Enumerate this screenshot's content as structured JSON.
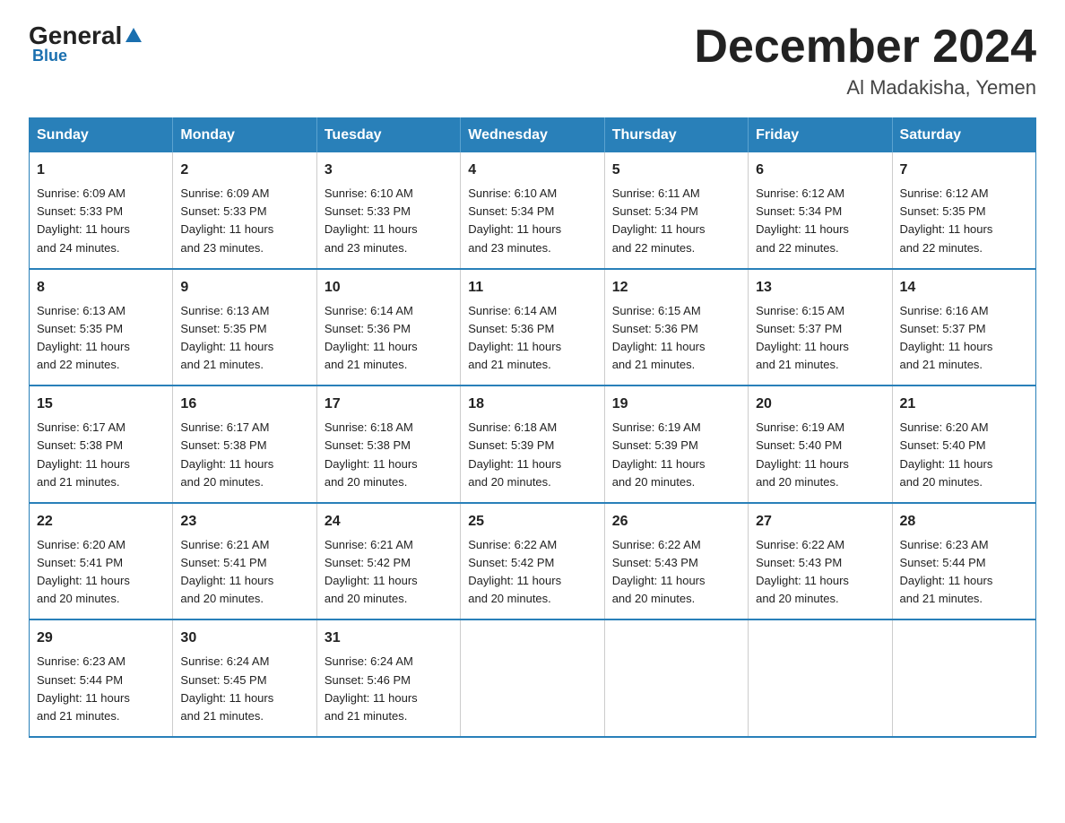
{
  "logo": {
    "general": "General",
    "blue": "Blue"
  },
  "header": {
    "month": "December 2024",
    "location": "Al Madakisha, Yemen"
  },
  "weekdays": [
    "Sunday",
    "Monday",
    "Tuesday",
    "Wednesday",
    "Thursday",
    "Friday",
    "Saturday"
  ],
  "weeks": [
    [
      {
        "day": "1",
        "sunrise": "6:09 AM",
        "sunset": "5:33 PM",
        "daylight": "11 hours and 24 minutes."
      },
      {
        "day": "2",
        "sunrise": "6:09 AM",
        "sunset": "5:33 PM",
        "daylight": "11 hours and 23 minutes."
      },
      {
        "day": "3",
        "sunrise": "6:10 AM",
        "sunset": "5:33 PM",
        "daylight": "11 hours and 23 minutes."
      },
      {
        "day": "4",
        "sunrise": "6:10 AM",
        "sunset": "5:34 PM",
        "daylight": "11 hours and 23 minutes."
      },
      {
        "day": "5",
        "sunrise": "6:11 AM",
        "sunset": "5:34 PM",
        "daylight": "11 hours and 22 minutes."
      },
      {
        "day": "6",
        "sunrise": "6:12 AM",
        "sunset": "5:34 PM",
        "daylight": "11 hours and 22 minutes."
      },
      {
        "day": "7",
        "sunrise": "6:12 AM",
        "sunset": "5:35 PM",
        "daylight": "11 hours and 22 minutes."
      }
    ],
    [
      {
        "day": "8",
        "sunrise": "6:13 AM",
        "sunset": "5:35 PM",
        "daylight": "11 hours and 22 minutes."
      },
      {
        "day": "9",
        "sunrise": "6:13 AM",
        "sunset": "5:35 PM",
        "daylight": "11 hours and 21 minutes."
      },
      {
        "day": "10",
        "sunrise": "6:14 AM",
        "sunset": "5:36 PM",
        "daylight": "11 hours and 21 minutes."
      },
      {
        "day": "11",
        "sunrise": "6:14 AM",
        "sunset": "5:36 PM",
        "daylight": "11 hours and 21 minutes."
      },
      {
        "day": "12",
        "sunrise": "6:15 AM",
        "sunset": "5:36 PM",
        "daylight": "11 hours and 21 minutes."
      },
      {
        "day": "13",
        "sunrise": "6:15 AM",
        "sunset": "5:37 PM",
        "daylight": "11 hours and 21 minutes."
      },
      {
        "day": "14",
        "sunrise": "6:16 AM",
        "sunset": "5:37 PM",
        "daylight": "11 hours and 21 minutes."
      }
    ],
    [
      {
        "day": "15",
        "sunrise": "6:17 AM",
        "sunset": "5:38 PM",
        "daylight": "11 hours and 21 minutes."
      },
      {
        "day": "16",
        "sunrise": "6:17 AM",
        "sunset": "5:38 PM",
        "daylight": "11 hours and 20 minutes."
      },
      {
        "day": "17",
        "sunrise": "6:18 AM",
        "sunset": "5:38 PM",
        "daylight": "11 hours and 20 minutes."
      },
      {
        "day": "18",
        "sunrise": "6:18 AM",
        "sunset": "5:39 PM",
        "daylight": "11 hours and 20 minutes."
      },
      {
        "day": "19",
        "sunrise": "6:19 AM",
        "sunset": "5:39 PM",
        "daylight": "11 hours and 20 minutes."
      },
      {
        "day": "20",
        "sunrise": "6:19 AM",
        "sunset": "5:40 PM",
        "daylight": "11 hours and 20 minutes."
      },
      {
        "day": "21",
        "sunrise": "6:20 AM",
        "sunset": "5:40 PM",
        "daylight": "11 hours and 20 minutes."
      }
    ],
    [
      {
        "day": "22",
        "sunrise": "6:20 AM",
        "sunset": "5:41 PM",
        "daylight": "11 hours and 20 minutes."
      },
      {
        "day": "23",
        "sunrise": "6:21 AM",
        "sunset": "5:41 PM",
        "daylight": "11 hours and 20 minutes."
      },
      {
        "day": "24",
        "sunrise": "6:21 AM",
        "sunset": "5:42 PM",
        "daylight": "11 hours and 20 minutes."
      },
      {
        "day": "25",
        "sunrise": "6:22 AM",
        "sunset": "5:42 PM",
        "daylight": "11 hours and 20 minutes."
      },
      {
        "day": "26",
        "sunrise": "6:22 AM",
        "sunset": "5:43 PM",
        "daylight": "11 hours and 20 minutes."
      },
      {
        "day": "27",
        "sunrise": "6:22 AM",
        "sunset": "5:43 PM",
        "daylight": "11 hours and 20 minutes."
      },
      {
        "day": "28",
        "sunrise": "6:23 AM",
        "sunset": "5:44 PM",
        "daylight": "11 hours and 21 minutes."
      }
    ],
    [
      {
        "day": "29",
        "sunrise": "6:23 AM",
        "sunset": "5:44 PM",
        "daylight": "11 hours and 21 minutes."
      },
      {
        "day": "30",
        "sunrise": "6:24 AM",
        "sunset": "5:45 PM",
        "daylight": "11 hours and 21 minutes."
      },
      {
        "day": "31",
        "sunrise": "6:24 AM",
        "sunset": "5:46 PM",
        "daylight": "11 hours and 21 minutes."
      },
      null,
      null,
      null,
      null
    ]
  ],
  "labels": {
    "sunrise": "Sunrise:",
    "sunset": "Sunset:",
    "daylight": "Daylight:"
  }
}
